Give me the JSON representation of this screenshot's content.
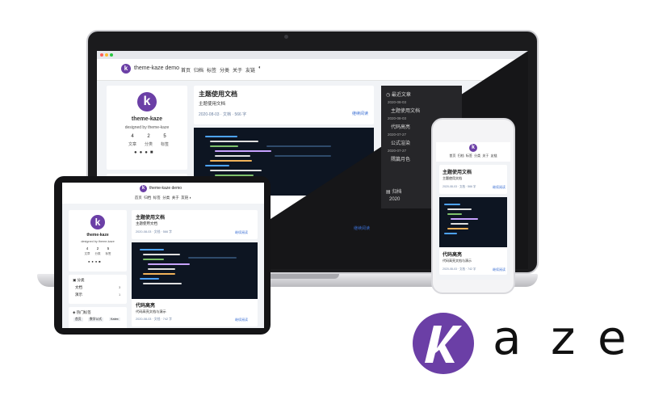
{
  "site": {
    "name": "theme-kaze demo",
    "nav": [
      "首页",
      "归档",
      "标签",
      "分类",
      "关于",
      "友链"
    ]
  },
  "profile": {
    "name": "theme-kaze",
    "subtitle": "designed by theme-kaze",
    "stats": [
      {
        "value": "4",
        "label": "文章"
      },
      {
        "value": "2",
        "label": "分类"
      },
      {
        "value": "5",
        "label": "标签"
      }
    ]
  },
  "posts": [
    {
      "title": "主题使用文档",
      "excerpt": "主题使用文档",
      "meta": "2020-08-03 · 文档 · 566 字",
      "read_more": "继续阅读"
    },
    {
      "title": "代码高亮",
      "excerpt": "代码高亮文档与演示",
      "meta": "2020-08-03 · 文档 · 742 字",
      "read_more": "继续阅读"
    }
  ],
  "recent": {
    "header": "最近文章",
    "items": [
      {
        "date": "2020-08-03",
        "title": "主题使用文档"
      },
      {
        "date": "2020-08-03",
        "title": "代码高亮"
      },
      {
        "date": "2020-07-27",
        "title": "公式渲染"
      },
      {
        "date": "2020-07-27",
        "title": "隅篇月色"
      }
    ]
  },
  "archive": {
    "header": "归档",
    "year": "2020"
  },
  "categories": {
    "header": "分类",
    "items": [
      {
        "name": "文档",
        "count": "3"
      },
      {
        "name": "演示",
        "count": "1"
      }
    ]
  },
  "tags": {
    "header": "热门标签",
    "items": [
      "首页",
      "数学公式",
      "Katex"
    ]
  },
  "brand": {
    "letters": [
      "a",
      "z",
      "e"
    ],
    "color": "#6b3fa6"
  }
}
